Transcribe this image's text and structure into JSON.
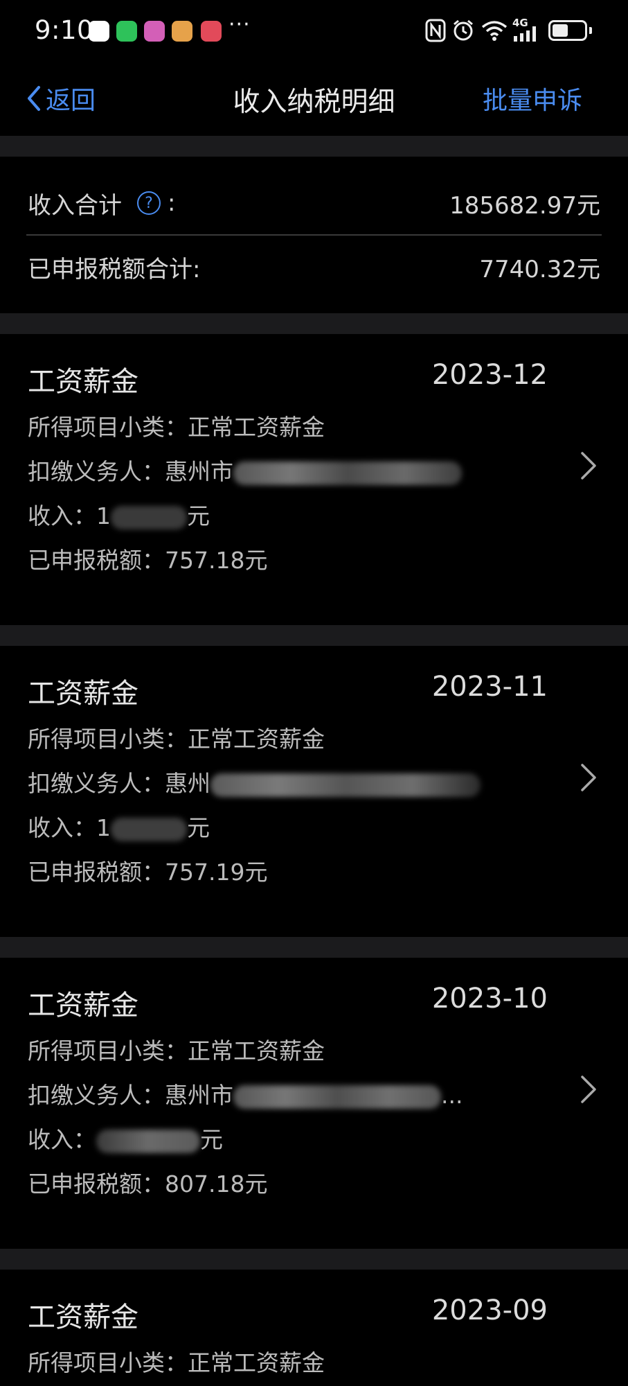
{
  "status": {
    "time": "9:10",
    "dots": "···",
    "network": "4G"
  },
  "nav": {
    "back_label": "返回",
    "title": "收入纳税明细",
    "batch_label": "批量申诉"
  },
  "summary": {
    "income_label": "收入合计",
    "income_colon": ":",
    "income_value": "185682.97元",
    "tax_label": "已申报税额合计:",
    "tax_value": "7740.32元"
  },
  "records": [
    {
      "title": "工资薪金",
      "date": "2023-12",
      "subcat": "所得项目小类：正常工资薪金",
      "payer_label": "扣缴义务人：惠州市",
      "income_label": "收入：1",
      "income_suffix": "元",
      "tax": "已申报税额：757.18元"
    },
    {
      "title": "工资薪金",
      "date": "2023-11",
      "subcat": "所得项目小类：正常工资薪金",
      "payer_label": "扣缴义务人：惠州",
      "income_label": "收入：1",
      "income_suffix": "元",
      "tax": "已申报税额：757.19元"
    },
    {
      "title": "工资薪金",
      "date": "2023-10",
      "subcat": "所得项目小类：正常工资薪金",
      "payer_label": "扣缴义务人：惠州市",
      "payer_suffix": "...",
      "income_label": "收入：",
      "income_suffix": "元",
      "tax": "已申报税额：807.18元"
    },
    {
      "title": "工资薪金",
      "date": "2023-09",
      "subcat": "所得项目小类：正常工资薪金"
    }
  ],
  "colors": {
    "accent": "#4a8cf0",
    "background": "#000000",
    "divider": "#1b1b1d"
  }
}
